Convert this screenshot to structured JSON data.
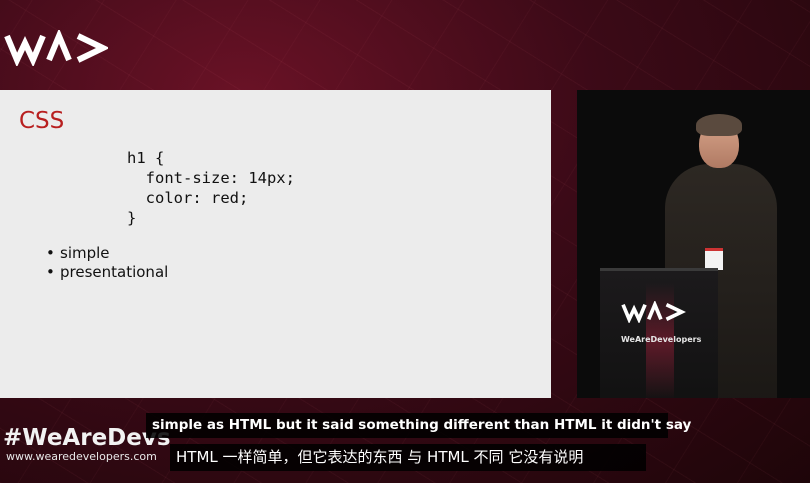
{
  "brand": {
    "logo_icon": "wearedevelopers-logo",
    "hashtag": "#WeAreDevs",
    "website": "www.wearedevelopers.com",
    "podium_text": "WeAreDevelopers"
  },
  "slide": {
    "title": "CSS",
    "code": "h1 {\n  font-size: 14px;\n  color: red;\n}",
    "bullets": [
      "simple",
      "presentational"
    ]
  },
  "subtitles": {
    "english": "simple as HTML but it said something different than HTML it didn't say",
    "chinese": "HTML 一样简单，但它表达的东西 与 HTML 不同 它没有说明"
  },
  "colors": {
    "title": "#b81f1f",
    "background": "#3b0a17"
  }
}
